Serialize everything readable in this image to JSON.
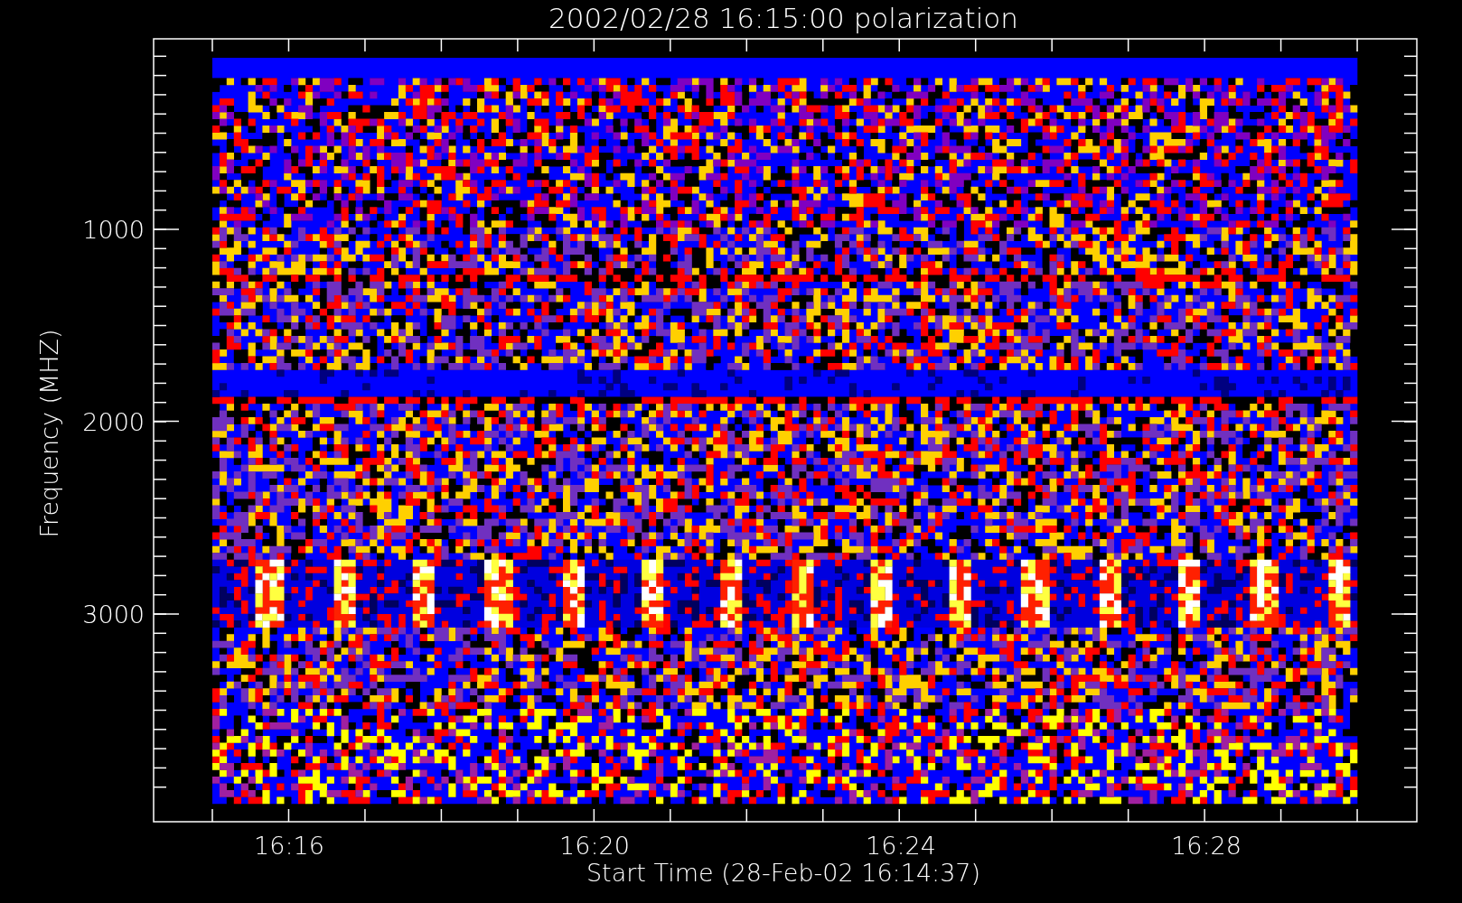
{
  "plot": {
    "title": "2002/02/28 16:15:00 polarization",
    "ylabel": "Frequency (MHZ)",
    "xlabel": "Start Time (28-Feb-02 16:14:37)",
    "ytick_labels": [
      "1000",
      "2000",
      "3000"
    ],
    "xtick_labels": [
      "16:16",
      "16:20",
      "16:24",
      "16:28"
    ]
  }
}
